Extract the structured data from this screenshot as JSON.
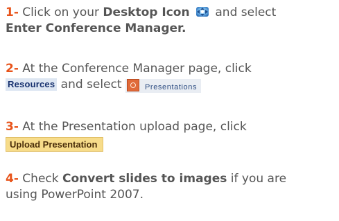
{
  "steps": [
    {
      "number": "1-",
      "text_a": "Click on your ",
      "bold_a": "Desktop Icon",
      "icon": "desktop-icon",
      "text_b": " and select",
      "bold_b": "Enter Conference Manager."
    },
    {
      "number": "2-",
      "text_a": "At the Conference Manager page, click",
      "button_a": "Resources",
      "text_b": " and select ",
      "icon": "presentations-icon",
      "button_b": "Presentations"
    },
    {
      "number": "3-",
      "text_a": "At the Presentation upload page, click",
      "button_a": "Upload Presentation"
    },
    {
      "number": "4-",
      "text_a": "Check ",
      "bold_a": "Convert slides to images",
      "text_b": " if you are",
      "text_c": "using PowerPoint 2007."
    }
  ],
  "colors": {
    "step_number": "#e8541b",
    "body_text": "#555555",
    "resources_text": "#16306e",
    "upload_button_bg": "#f7dc8a"
  }
}
